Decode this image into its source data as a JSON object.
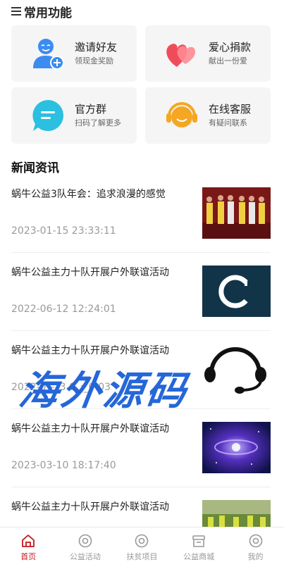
{
  "common": {
    "title": "常用功能"
  },
  "cards": [
    {
      "name": "邀请好友",
      "sub": "领现金奖励",
      "icon": "invite-friend-icon"
    },
    {
      "name": "爱心捐款",
      "sub": "献出一份爱",
      "icon": "heart-donation-icon"
    },
    {
      "name": "官方群",
      "sub": "扫码了解更多",
      "icon": "chat-group-icon"
    },
    {
      "name": "在线客服",
      "sub": "有疑问联系",
      "icon": "headset-service-icon"
    }
  ],
  "news": {
    "title": "新闻资讯",
    "items": [
      {
        "headline": "蜗牛公益3队年会：追求浪漫的感觉",
        "date": "2023-01-15 23:33:11",
        "thumb": "group-photo"
      },
      {
        "headline": "蜗牛公益主力十队开展户外联谊活动",
        "date": "2022-06-12 12:24:01",
        "thumb": "letter-c-logo"
      },
      {
        "headline": "蜗牛公益主力十队开展户外联谊活动",
        "date": "2022-0_-_3 0_:_0:03",
        "thumb": "none"
      },
      {
        "headline": "蜗牛公益主力十队开展户外联谊活动",
        "date": "2023-03-10 18:17:40",
        "thumb": "galaxy-photo"
      },
      {
        "headline": "蜗牛公益主力十队开展户外联谊活动",
        "date": "",
        "thumb": "outdoor-photo"
      }
    ]
  },
  "watermark": {
    "text": "海外源码"
  },
  "tabs": [
    {
      "label": "首页",
      "icon": "home-icon",
      "active": true
    },
    {
      "label": "公益活动",
      "icon": "activity-icon",
      "active": false
    },
    {
      "label": "扶贫项目",
      "icon": "project-icon",
      "active": false
    },
    {
      "label": "公益商城",
      "icon": "shop-icon",
      "active": false
    },
    {
      "label": "我的",
      "icon": "profile-icon",
      "active": false
    }
  ],
  "colors": {
    "accent": "#c8161d",
    "blue": "#3b8cf0",
    "red": "#f04b5a",
    "cyan": "#2bbfe0",
    "orange": "#f5a623"
  }
}
